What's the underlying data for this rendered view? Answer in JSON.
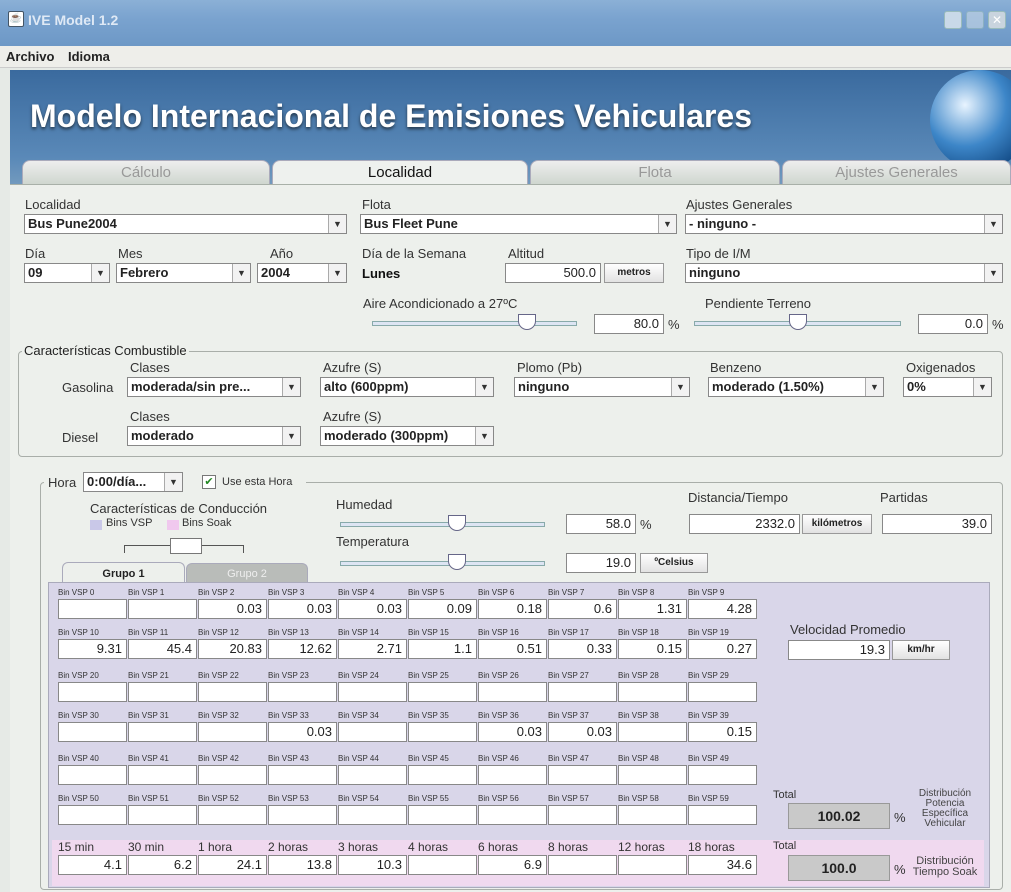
{
  "window": {
    "title": "IVE Model 1.2"
  },
  "menu": {
    "archivo": "Archivo",
    "idioma": "Idioma"
  },
  "banner": {
    "title": "Modelo Internacional de Emisiones Vehiculares"
  },
  "tabs": [
    "Cálculo",
    "Localidad",
    "Flota",
    "Ajustes Generales"
  ],
  "loc": {
    "localidad_label": "Localidad",
    "localidad": "Bus Pune2004",
    "flota_label": "Flota",
    "flota": "Bus Fleet Pune",
    "ajustes_label": "Ajustes Generales",
    "ajustes": "- ninguno -",
    "dia_label": "Día",
    "dia": "09",
    "mes_label": "Mes",
    "mes": "Febrero",
    "anio_label": "Año",
    "anio": "2004",
    "dia_semana_label": "Día de la Semana",
    "dia_semana": "Lunes",
    "altitud_label": "Altitud",
    "altitud": "500.0",
    "altitud_unit": "metros",
    "tipo_im_label": "Tipo de I/M",
    "tipo_im": "ninguno",
    "aire_label": "Aire Acondicionado a 27ºC",
    "aire": "80.0",
    "pct": "%",
    "pendiente_label": "Pendiente Terreno",
    "pendiente": "0.0"
  },
  "fuel": {
    "group_title": "Características Combustible",
    "clases_label": "Clases",
    "azufre_label": "Azufre (S)",
    "plomo_label": "Plomo (Pb)",
    "benzeno_label": "Benzeno",
    "oxigenados_label": "Oxigenados",
    "gasolina_label": "Gasolina",
    "gas_clase": "moderada/sin pre...",
    "gas_azufre": "alto (600ppm)",
    "gas_plomo": "ninguno",
    "gas_benzeno": "moderado (1.50%)",
    "gas_oxig": "0%",
    "diesel_label": "Diesel",
    "dsl_clase": "moderado",
    "dsl_azufre": "moderado (300ppm)"
  },
  "hora": {
    "label": "Hora",
    "value": "0:00/día...",
    "use_label": "Use esta Hora",
    "caract_label": "Características de Conducción",
    "bins_vsp": "Bins VSP",
    "bins_soak": "Bins Soak",
    "humedad_label": "Humedad",
    "humedad": "58.0",
    "temperatura_label": "Temperatura",
    "temperatura": "19.0",
    "temp_unit": "ºCelsius",
    "distancia_label": "Distancia/Tiempo",
    "distancia": "2332.0",
    "dist_unit": "kilómetros",
    "partidas_label": "Partidas",
    "partidas": "39.0",
    "grupo1": "Grupo 1",
    "grupo2": "Grupo 2",
    "velocidad_label": "Velocidad Promedio",
    "velocidad": "19.3",
    "vel_unit": "km/hr",
    "total_label": "Total",
    "total_vsp": "100.02",
    "dist_potencia": "Distribución Potencia Específica Vehicular",
    "total_soak": "100.0",
    "dist_soak": "Distribución Tiempo Soak"
  },
  "vsp_rows": [
    {
      "labels": [
        "Bin VSP 0",
        "Bin VSP 1",
        "Bin VSP 2",
        "Bin VSP 3",
        "Bin VSP 4",
        "Bin VSP 5",
        "Bin VSP 6",
        "Bin VSP 7",
        "Bin VSP 8",
        "Bin VSP 9"
      ],
      "values": [
        "",
        "",
        "0.03",
        "0.03",
        "0.03",
        "0.09",
        "0.18",
        "0.6",
        "1.31",
        "4.28"
      ]
    },
    {
      "labels": [
        "Bin VSP 10",
        "Bin VSP 11",
        "Bin VSP 12",
        "Bin VSP 13",
        "Bin VSP 14",
        "Bin VSP 15",
        "Bin VSP 16",
        "Bin VSP 17",
        "Bin VSP 18",
        "Bin VSP 19"
      ],
      "values": [
        "9.31",
        "45.4",
        "20.83",
        "12.62",
        "2.71",
        "1.1",
        "0.51",
        "0.33",
        "0.15",
        "0.27"
      ]
    },
    {
      "labels": [
        "Bin VSP 20",
        "Bin VSP 21",
        "Bin VSP 22",
        "Bin VSP 23",
        "Bin VSP 24",
        "Bin VSP 25",
        "Bin VSP 26",
        "Bin VSP 27",
        "Bin VSP 28",
        "Bin VSP 29"
      ],
      "values": [
        "",
        "",
        "",
        "",
        "",
        "",
        "",
        "",
        "",
        ""
      ]
    },
    {
      "labels": [
        "Bin VSP 30",
        "Bin VSP 31",
        "Bin VSP 32",
        "Bin VSP 33",
        "Bin VSP 34",
        "Bin VSP 35",
        "Bin VSP 36",
        "Bin VSP 37",
        "Bin VSP 38",
        "Bin VSP 39"
      ],
      "values": [
        "",
        "",
        "",
        "0.03",
        "",
        "",
        "0.03",
        "0.03",
        "",
        "0.15"
      ]
    },
    {
      "labels": [
        "Bin VSP 40",
        "Bin VSP 41",
        "Bin VSP 42",
        "Bin VSP 43",
        "Bin VSP 44",
        "Bin VSP 45",
        "Bin VSP 46",
        "Bin VSP 47",
        "Bin VSP 48",
        "Bin VSP 49"
      ],
      "values": [
        "",
        "",
        "",
        "",
        "",
        "",
        "",
        "",
        "",
        ""
      ]
    },
    {
      "labels": [
        "Bin VSP 50",
        "Bin VSP 51",
        "Bin VSP 52",
        "Bin VSP 53",
        "Bin VSP 54",
        "Bin VSP 55",
        "Bin VSP 56",
        "Bin VSP 57",
        "Bin VSP 58",
        "Bin VSP 59"
      ],
      "values": [
        "",
        "",
        "",
        "",
        "",
        "",
        "",
        "",
        "",
        ""
      ]
    }
  ],
  "soak": {
    "labels": [
      "15 min",
      "30 min",
      "1 hora",
      "2 horas",
      "3 horas",
      "4 horas",
      "6 horas",
      "8 horas",
      "12 horas",
      "18 horas"
    ],
    "values": [
      "4.1",
      "6.2",
      "24.1",
      "13.8",
      "10.3",
      "",
      "6.9",
      "",
      "",
      "34.6"
    ]
  },
  "sliders": {
    "aire_level": 0.78,
    "pendiente_level": 0.5,
    "humedad_level": 0.58,
    "temperatura_level": 0.58
  }
}
